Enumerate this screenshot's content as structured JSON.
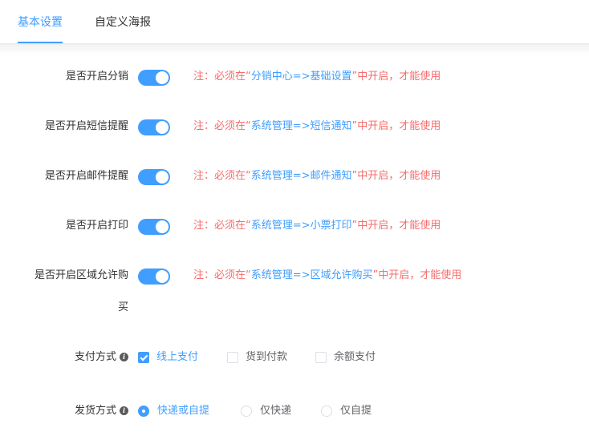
{
  "tabs": [
    {
      "label": "基本设置",
      "active": true
    },
    {
      "label": "自定义海报",
      "active": false
    }
  ],
  "settings": [
    {
      "label": "是否开启分销",
      "enabled": true,
      "note_prefix": "注：必须在“",
      "note_path": "分销中心=>基础设置",
      "note_suffix": "”中开启，才能使用"
    },
    {
      "label": "是否开启短信提醒",
      "enabled": true,
      "note_prefix": "注：必须在“",
      "note_path": "系统管理=>短信通知",
      "note_suffix": "”中开启，才能使用"
    },
    {
      "label": "是否开启邮件提醒",
      "enabled": true,
      "note_prefix": "注：必须在“",
      "note_path": "系统管理=>邮件通知",
      "note_suffix": "”中开启，才能使用"
    },
    {
      "label": "是否开启打印",
      "enabled": true,
      "note_prefix": "注：必须在“",
      "note_path": "系统管理=>小票打印",
      "note_suffix": "”中开启，才能使用"
    },
    {
      "label": "是否开启区域允许购买",
      "enabled": true,
      "note_prefix": "注：必须在“",
      "note_path": "系统管理=>区域允许购买",
      "note_suffix": "”中开启，才能使用"
    }
  ],
  "payment": {
    "label": "支付方式",
    "options": [
      {
        "label": "线上支付",
        "checked": true
      },
      {
        "label": "货到付款",
        "checked": false
      },
      {
        "label": "余额支付",
        "checked": false
      }
    ]
  },
  "shipping": {
    "label": "发货方式",
    "options": [
      {
        "label": "快递或自提",
        "selected": true
      },
      {
        "label": "仅快递",
        "selected": false
      },
      {
        "label": "仅自提",
        "selected": false
      }
    ]
  },
  "colors": {
    "accent": "#409eff",
    "warning": "#f56c6c"
  }
}
